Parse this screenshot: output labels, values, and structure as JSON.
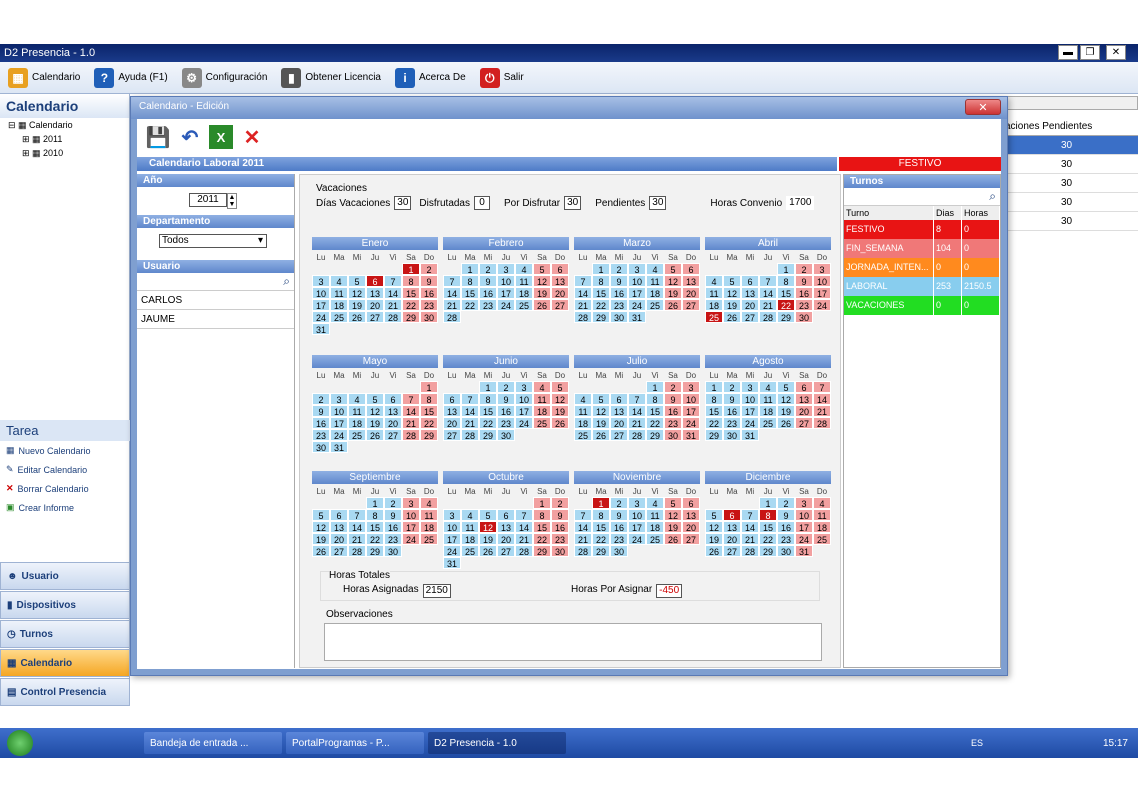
{
  "window": {
    "title": "D2 Presencia - 1.0",
    "min": "▬",
    "max": "❐",
    "close": "✕"
  },
  "toolbar": [
    {
      "label": "Calendario",
      "icon": "calendar-icon",
      "color": "#e8a020"
    },
    {
      "label": "Ayuda (F1)",
      "icon": "help-icon",
      "color": "#1f5fb8"
    },
    {
      "label": "Configuración",
      "icon": "gear-icon",
      "color": "#888888"
    },
    {
      "label": "Obtener Licencia",
      "icon": "license-icon",
      "color": "#555555"
    },
    {
      "label": "Acerca De",
      "icon": "info-icon",
      "color": "#1f5fb8"
    },
    {
      "label": "Salir",
      "icon": "power-icon",
      "color": "#d22020"
    }
  ],
  "left": {
    "title": "Calendario",
    "tree": [
      "Calendario",
      "2011",
      "2010"
    ],
    "tarea_title": "Tarea",
    "tareas": [
      "Nuevo Calendario",
      "Editar Calendario",
      "Borrar Calendario",
      "Crear Informe"
    ],
    "nav": [
      "Usuario",
      "Dispositivos",
      "Turnos",
      "Calendario",
      "Control Presencia"
    ]
  },
  "right": {
    "header": "aciones Pendientes",
    "values": [
      "30",
      "30",
      "30",
      "30",
      "30"
    ]
  },
  "dialog": {
    "title": "Calendario - Edición",
    "close": "✕",
    "bar": "Calendario Laboral 2011",
    "festivo_bar": "FESTIVO",
    "anio_label": "Año",
    "anio": "2011",
    "depto_label": "Departamento",
    "depto": "Todos",
    "usuario_label": "Usuario",
    "usuarios": [
      "CARLOS",
      "JAUME"
    ],
    "vac_title": "Vacaciones",
    "vac_dias_label": "Días Vacaciones",
    "vac_dias": "30",
    "disfrutadas_label": "Disfrutadas",
    "disfrutadas": "0",
    "por_disfrutar_label": "Por Disfrutar",
    "por_disfrutar": "30",
    "pendientes_label": "Pendientes",
    "pendientes": "30",
    "horas_convenio_label": "Horas Convenio",
    "horas_convenio": "1700",
    "horas_totales_label": "Horas Totales",
    "horas_asignadas_label": "Horas Asignadas",
    "horas_asignadas": "2150",
    "horas_por_asignar_label": "Horas Por Asignar",
    "horas_por_asignar": "-450",
    "observaciones_label": "Observaciones",
    "turnos_label": "Turnos",
    "turnos_headers": [
      "Turno",
      "Dias",
      "Horas"
    ],
    "turnos": [
      {
        "name": "FESTIVO",
        "dias": "8",
        "horas": "0",
        "color": "#e81414"
      },
      {
        "name": "FIN_SEMANA",
        "dias": "104",
        "horas": "0",
        "color": "#f07878"
      },
      {
        "name": "JORNADA_INTEN...",
        "dias": "0",
        "horas": "0",
        "color": "#ff8a1e"
      },
      {
        "name": "LABORAL",
        "dias": "253",
        "horas": "2150.5",
        "color": "#88cdee"
      },
      {
        "name": "VACACIONES",
        "dias": "0",
        "horas": "0",
        "color": "#22dd22"
      }
    ]
  },
  "dow": [
    "Lu",
    "Ma",
    "Mi",
    "Ju",
    "Vi",
    "Sa",
    "Do"
  ],
  "months": [
    {
      "name": "Enero",
      "start": 5,
      "len": 31,
      "hol": [
        1,
        6
      ]
    },
    {
      "name": "Febrero",
      "start": 1,
      "len": 28,
      "hol": []
    },
    {
      "name": "Marzo",
      "start": 1,
      "len": 31,
      "hol": []
    },
    {
      "name": "Abril",
      "start": 4,
      "len": 30,
      "hol": [
        22,
        25
      ]
    },
    {
      "name": "Mayo",
      "start": 6,
      "len": 31,
      "hol": []
    },
    {
      "name": "Junio",
      "start": 2,
      "len": 30,
      "hol": []
    },
    {
      "name": "Julio",
      "start": 4,
      "len": 31,
      "hol": []
    },
    {
      "name": "Agosto",
      "start": 0,
      "len": 31,
      "hol": []
    },
    {
      "name": "Septiembre",
      "start": 3,
      "len": 30,
      "hol": []
    },
    {
      "name": "Octubre",
      "start": 5,
      "len": 31,
      "hol": [
        12
      ]
    },
    {
      "name": "Noviembre",
      "start": 1,
      "len": 30,
      "hol": [
        1
      ]
    },
    {
      "name": "Diciembre",
      "start": 3,
      "len": 31,
      "hol": [
        6,
        8
      ]
    }
  ],
  "taskbar": {
    "items": [
      "Bandeja de entrada ...",
      "PortalProgramas - P...",
      "D2 Presencia - 1.0"
    ],
    "lang": "ES",
    "time": "15:17"
  }
}
